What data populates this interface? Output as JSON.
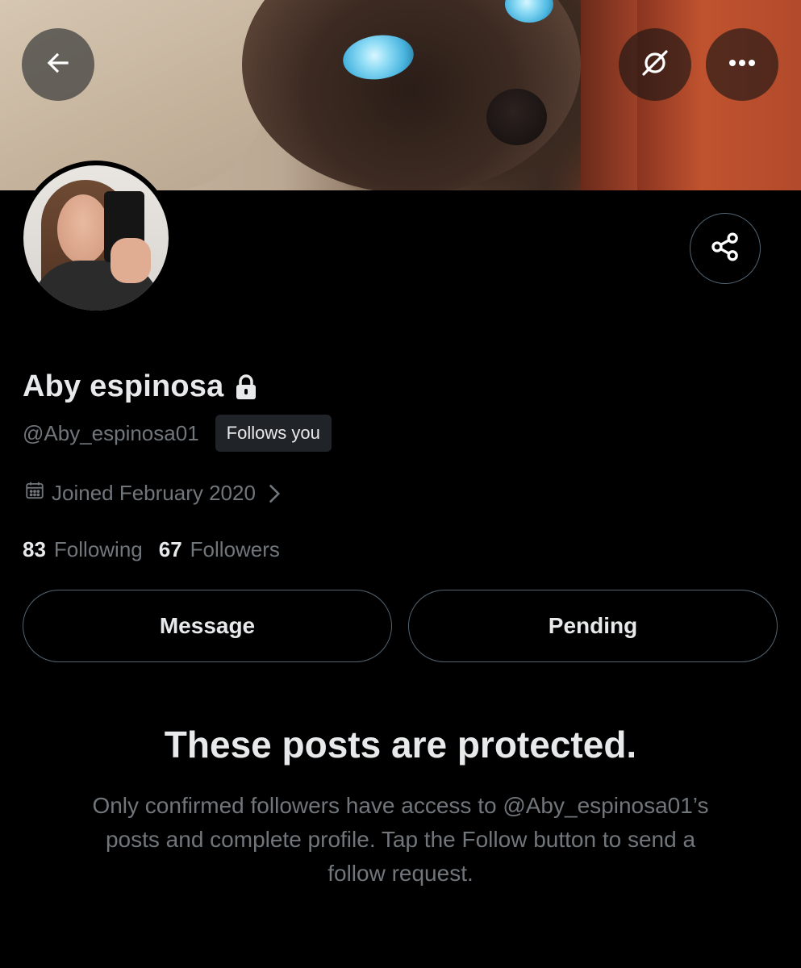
{
  "header": {
    "back_icon": "arrow-left-icon",
    "grok_icon": "grok-icon",
    "more_icon": "more-horizontal-icon"
  },
  "profile": {
    "display_name": "Aby espinosa",
    "protected_icon": "lock-icon",
    "handle": "@Aby_espinosa01",
    "follows_you_label": "Follows you",
    "joined_icon": "calendar-icon",
    "joined_text": "Joined February 2020",
    "following_count": "83",
    "following_label": "Following",
    "followers_count": "67",
    "followers_label": "Followers",
    "share_icon": "share-icon"
  },
  "actions": {
    "message_label": "Message",
    "pending_label": "Pending"
  },
  "protected_notice": {
    "title": "These posts are protected.",
    "body": "Only confirmed followers have access to @Aby_espinosa01’s posts and complete profile. Tap the Follow button to send a follow request."
  },
  "colors": {
    "background": "#000000",
    "primary_text": "#e7e9ea",
    "secondary_text": "#71767b",
    "border": "#536471",
    "badge_bg": "#202327"
  }
}
